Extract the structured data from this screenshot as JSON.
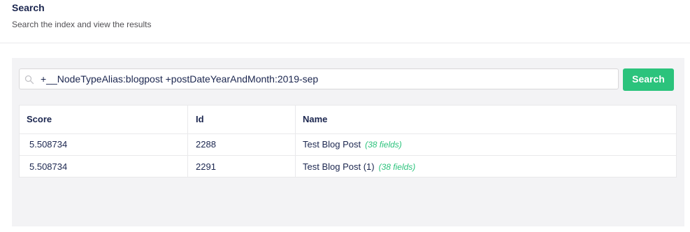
{
  "header": {
    "title": "Search",
    "subtitle": "Search the index and view the results"
  },
  "search": {
    "query": "+__NodeTypeAlias:blogpost +postDateYearAndMonth:2019-sep",
    "button_label": "Search",
    "icon": "search-icon"
  },
  "results": {
    "columns": [
      "Score",
      "Id",
      "Name"
    ],
    "rows": [
      {
        "score": "5.508734",
        "id": "2288",
        "name": "Test Blog Post",
        "fields": "(38 fields)"
      },
      {
        "score": "5.508734",
        "id": "2291",
        "name": "Test Blog Post (1)",
        "fields": "(38 fields)"
      }
    ]
  },
  "colors": {
    "accent": "#2bc37c",
    "text": "#1b264f",
    "panel_bg": "#f3f3f5"
  }
}
